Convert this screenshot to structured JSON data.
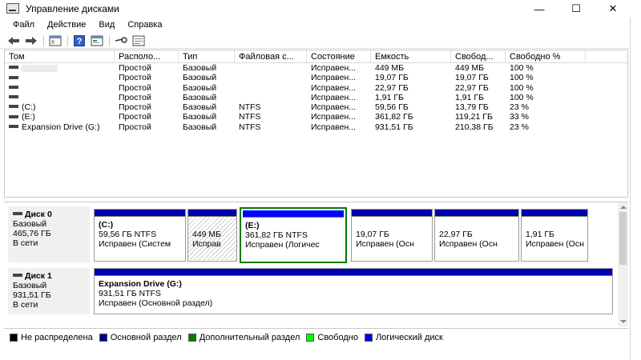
{
  "window": {
    "title": "Управление дисками",
    "minimize": "—",
    "maximize": "☐",
    "close": "✕"
  },
  "menu": [
    "Файл",
    "Действие",
    "Вид",
    "Справка"
  ],
  "volume_list": {
    "columns": [
      "Том",
      "Располо...",
      "Тип",
      "Файловая с...",
      "Состояние",
      "Емкость",
      "Свобод...",
      "Свободно %"
    ],
    "rows": [
      {
        "name": "",
        "layout": "Простой",
        "type": "Базовый",
        "fs": "",
        "status": "Исправен...",
        "capacity": "449 МБ",
        "free": "449 МБ",
        "free_pct": "100 %"
      },
      {
        "name": "",
        "layout": "Простой",
        "type": "Базовый",
        "fs": "",
        "status": "Исправен...",
        "capacity": "19,07 ГБ",
        "free": "19,07 ГБ",
        "free_pct": "100 %"
      },
      {
        "name": "",
        "layout": "Простой",
        "type": "Базовый",
        "fs": "",
        "status": "Исправен...",
        "capacity": "22,97 ГБ",
        "free": "22,97 ГБ",
        "free_pct": "100 %"
      },
      {
        "name": "",
        "layout": "Простой",
        "type": "Базовый",
        "fs": "",
        "status": "Исправен...",
        "capacity": "1,91 ГБ",
        "free": "1,91 ГБ",
        "free_pct": "100 %"
      },
      {
        "name": "(C:)",
        "layout": "Простой",
        "type": "Базовый",
        "fs": "NTFS",
        "status": "Исправен...",
        "capacity": "59,56 ГБ",
        "free": "13,79 ГБ",
        "free_pct": "23 %"
      },
      {
        "name": "(E:)",
        "layout": "Простой",
        "type": "Базовый",
        "fs": "NTFS",
        "status": "Исправен...",
        "capacity": "361,82 ГБ",
        "free": "119,21 ГБ",
        "free_pct": "33 %"
      },
      {
        "name": "Expansion Drive (G:)",
        "layout": "Простой",
        "type": "Базовый",
        "fs": "NTFS",
        "status": "Исправен...",
        "capacity": "931,51 ГБ",
        "free": "210,38 ГБ",
        "free_pct": "23 %"
      }
    ]
  },
  "disks": [
    {
      "title": "Диск 0",
      "type": "Базовый",
      "size": "465,76 ГБ",
      "state": "В сети",
      "partitions": [
        {
          "name": "(C:)",
          "size": "59,56 ГБ NTFS",
          "status": "Исправен (Систем"
        },
        {
          "name": "",
          "size": "449 МБ",
          "status": "Исправ"
        },
        {
          "name": "(E:)",
          "size": "361,82 ГБ NTFS",
          "status": "Исправен (Логичес"
        },
        {
          "name": "",
          "size": "19,07 ГБ",
          "status": "Исправен (Осн"
        },
        {
          "name": "",
          "size": "22,97 ГБ",
          "status": "Исправен (Осн"
        },
        {
          "name": "",
          "size": "1,91 ГБ",
          "status": "Исправен (Осн"
        }
      ]
    },
    {
      "title": "Диск 1",
      "type": "Базовый",
      "size": "931,51 ГБ",
      "state": "В сети",
      "partitions": [
        {
          "name": "Expansion Drive  (G:)",
          "size": "931,51 ГБ NTFS",
          "status": "Исправен (Основной раздел)"
        }
      ]
    }
  ],
  "legend": [
    {
      "label": "Не распределена",
      "color": "#000000"
    },
    {
      "label": "Основной раздел",
      "color": "#00007f"
    },
    {
      "label": "Дополнительный раздел",
      "color": "#007f00"
    },
    {
      "label": "Свободно",
      "color": "#00ff00"
    },
    {
      "label": "Логический диск",
      "color": "#0000ff"
    }
  ],
  "icons": {
    "toolbar": [
      "back-icon",
      "forward-icon",
      "show-hide-console-tree-icon",
      "help-icon",
      "properties-icon",
      "key-icon",
      "settings-icon"
    ]
  }
}
